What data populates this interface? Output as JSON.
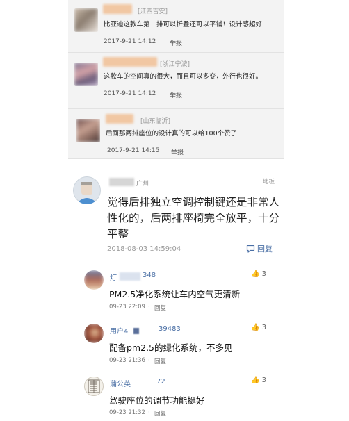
{
  "old_comments": [
    {
      "location": "[江西吉安]",
      "text": "比亚迪这款车第二排可以折叠还可以平铺！设计感超好",
      "time": "2017-9-21 14:12",
      "report": "举报"
    },
    {
      "location": "[浙江宁波]",
      "text": "这款车的空间真的很大，而且可以多变，外行也很好。",
      "time": "2017-9-21 14:12",
      "report": "举报"
    },
    {
      "location": "[山东临沂]",
      "text": "后面那两排座位的设计真的可以给100个赞了",
      "time": "2017-9-21 14:15",
      "report": "举报"
    }
  ],
  "main_comment": {
    "location": "广州",
    "floor": "地板",
    "text_lines": [
      "觉得后排独立空调控制键还是非常人",
      "性化的，后两排座椅完全放平，十分",
      "平整"
    ],
    "time": "2018-08-03 14:59:04",
    "reply_label": "回复"
  },
  "replies": [
    {
      "name_prefix": "灯",
      "name_suffix": "348",
      "likes": "3",
      "text": "PM2.5净化系统让车内空气更清新",
      "time": "09-23 22:09",
      "reply_label": "回复"
    },
    {
      "name_prefix": "用户4",
      "name_suffix": "39483",
      "likes": "3",
      "text": "配备pm2.5的绿化系统，不多见",
      "time": "09-23 21:36",
      "reply_label": "回复"
    },
    {
      "name_prefix": "蒲公英",
      "name_suffix": "72",
      "likes": "3",
      "text": "驾驶座位的调节功能挺好",
      "time": "09-23 21:32",
      "reply_label": "回复"
    }
  ],
  "colors": {
    "link_blue": "#4a6fa5",
    "card_bg": "#f3f3f3",
    "location_gray": "#999999"
  }
}
